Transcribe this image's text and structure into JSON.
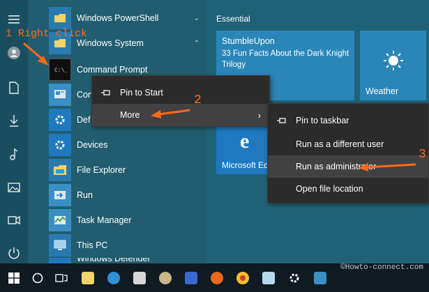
{
  "annotations": {
    "step1": "1 Right click",
    "step2": "2",
    "step3": "3"
  },
  "applist": {
    "items": [
      {
        "label": "Windows PowerShell",
        "icon": "folder-icon"
      },
      {
        "label": "Windows System",
        "icon": "folder-icon"
      },
      {
        "label": "Command Prompt",
        "icon": "command-prompt-icon"
      },
      {
        "label": "Con",
        "icon": "control-panel-icon"
      },
      {
        "label": "Def",
        "icon": "gear-icon"
      },
      {
        "label": "Devices",
        "icon": "gear-icon"
      },
      {
        "label": "File Explorer",
        "icon": "file-explorer-icon"
      },
      {
        "label": "Run",
        "icon": "run-icon"
      },
      {
        "label": "Task Manager",
        "icon": "task-manager-icon"
      },
      {
        "label": "This PC",
        "icon": "this-pc-icon"
      },
      {
        "label": "Windows Defender",
        "icon": "windows-defender-icon"
      }
    ]
  },
  "tiles": {
    "group": "Essential",
    "stumble": {
      "title": "StumbleUpon",
      "line1": "33 Fun Facts About the Dark Knight",
      "line2": "Trilogy"
    },
    "weather": "Weather",
    "edge": "Microsoft Ed"
  },
  "menu1": {
    "pin_start": "Pin to Start",
    "more": "More"
  },
  "menu2": {
    "items": [
      "Pin to taskbar",
      "Run as a different user",
      "Run as administrator",
      "Open file location"
    ]
  },
  "watermark": "©Howto-connect.com",
  "colors": {
    "accent": "#2a86b8",
    "annotation": "#ff6a1a",
    "menu": "#2b2b2b"
  }
}
